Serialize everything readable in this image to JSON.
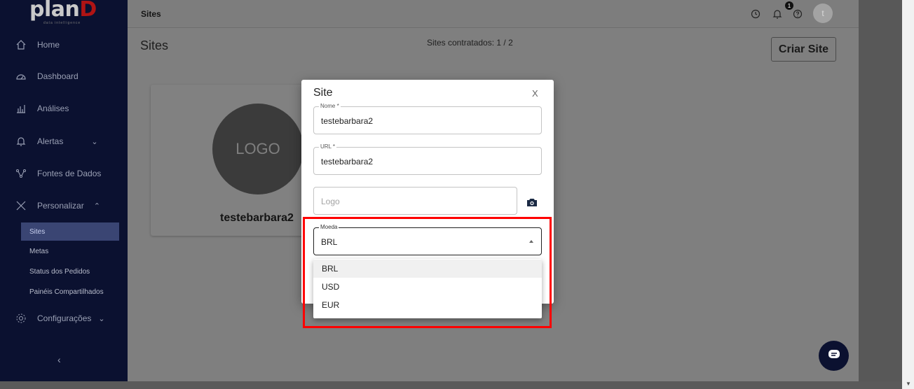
{
  "brand": {
    "name_main": "plan",
    "name_accent": "D",
    "tagline": "data intelligence"
  },
  "sidebar": {
    "items": [
      {
        "label": "Home",
        "icon": "home-icon"
      },
      {
        "label": "Dashboard",
        "icon": "gauge-icon"
      },
      {
        "label": "Análises",
        "icon": "chart-icon"
      },
      {
        "label": "Alertas",
        "icon": "bell-icon",
        "chevron": "⌄"
      },
      {
        "label": "Fontes de Dados",
        "icon": "network-icon"
      },
      {
        "label": "Personalizar",
        "icon": "tools-icon",
        "chevron": "⌃"
      },
      {
        "label": "Configurações",
        "icon": "gear-icon",
        "chevron": "⌄"
      }
    ],
    "subitems": [
      "Sites",
      "Metas",
      "Status dos Pedidos",
      "Painéis Compartilhados"
    ],
    "collapse": "‹"
  },
  "topbar": {
    "breadcrumb": "Sites",
    "notification_count": "1",
    "avatar_letter": "t"
  },
  "page": {
    "title": "Sites",
    "sites_count": "Sites contratados: 1 / 2",
    "create_button": "Criar Site",
    "card": {
      "logo_text": "LOGO",
      "name": "testebarbara2"
    }
  },
  "modal": {
    "title": "Site",
    "close": "X",
    "fields": {
      "nome": {
        "label": "Nome *",
        "value": "testebarbara2"
      },
      "url": {
        "label": "URL *",
        "value": "testebarbara2"
      },
      "logo": {
        "placeholder": "Logo"
      },
      "moeda": {
        "label": "Moeda",
        "value": "BRL"
      }
    },
    "dropdown_options": [
      "BRL",
      "USD",
      "EUR"
    ]
  },
  "colors": {
    "sidebar_bg": "#0b1130",
    "active_sub": "#3a4573",
    "brand_accent": "#b01414",
    "highlight": "#ff0000"
  }
}
